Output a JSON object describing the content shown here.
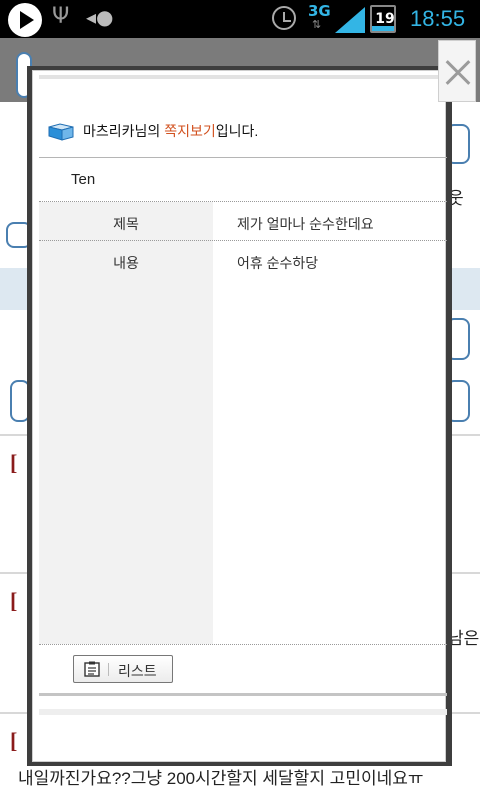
{
  "status_bar": {
    "network": "3G",
    "battery_level": "19",
    "time": "18:55",
    "icons": [
      "play-icon",
      "usb-icon",
      "sync-icon",
      "alarm-icon",
      "signal-icon",
      "battery-icon"
    ]
  },
  "modal": {
    "user_name": "마츠리카",
    "title_mid": "님의 ",
    "title_accent": "쪽지보기",
    "title_suffix": "입니다.",
    "sender": "Ten",
    "fields": [
      {
        "label": "제목",
        "value": "제가 얼마나 순수한데요"
      },
      {
        "label": "내용",
        "value": "어휴 순수하당"
      }
    ],
    "list_button_label": "리스트"
  },
  "background_page": {
    "post_fragment_1": "웃",
    "post_fragment_2": "남은",
    "post_fragment_3": "내일까진가요??그냥 200시간할지 세달할지 고민이네요ㅠ"
  },
  "colors": {
    "accent": "#d2511f",
    "status_blue": "#33b5e5",
    "label_bg": "#f2f2f2"
  }
}
